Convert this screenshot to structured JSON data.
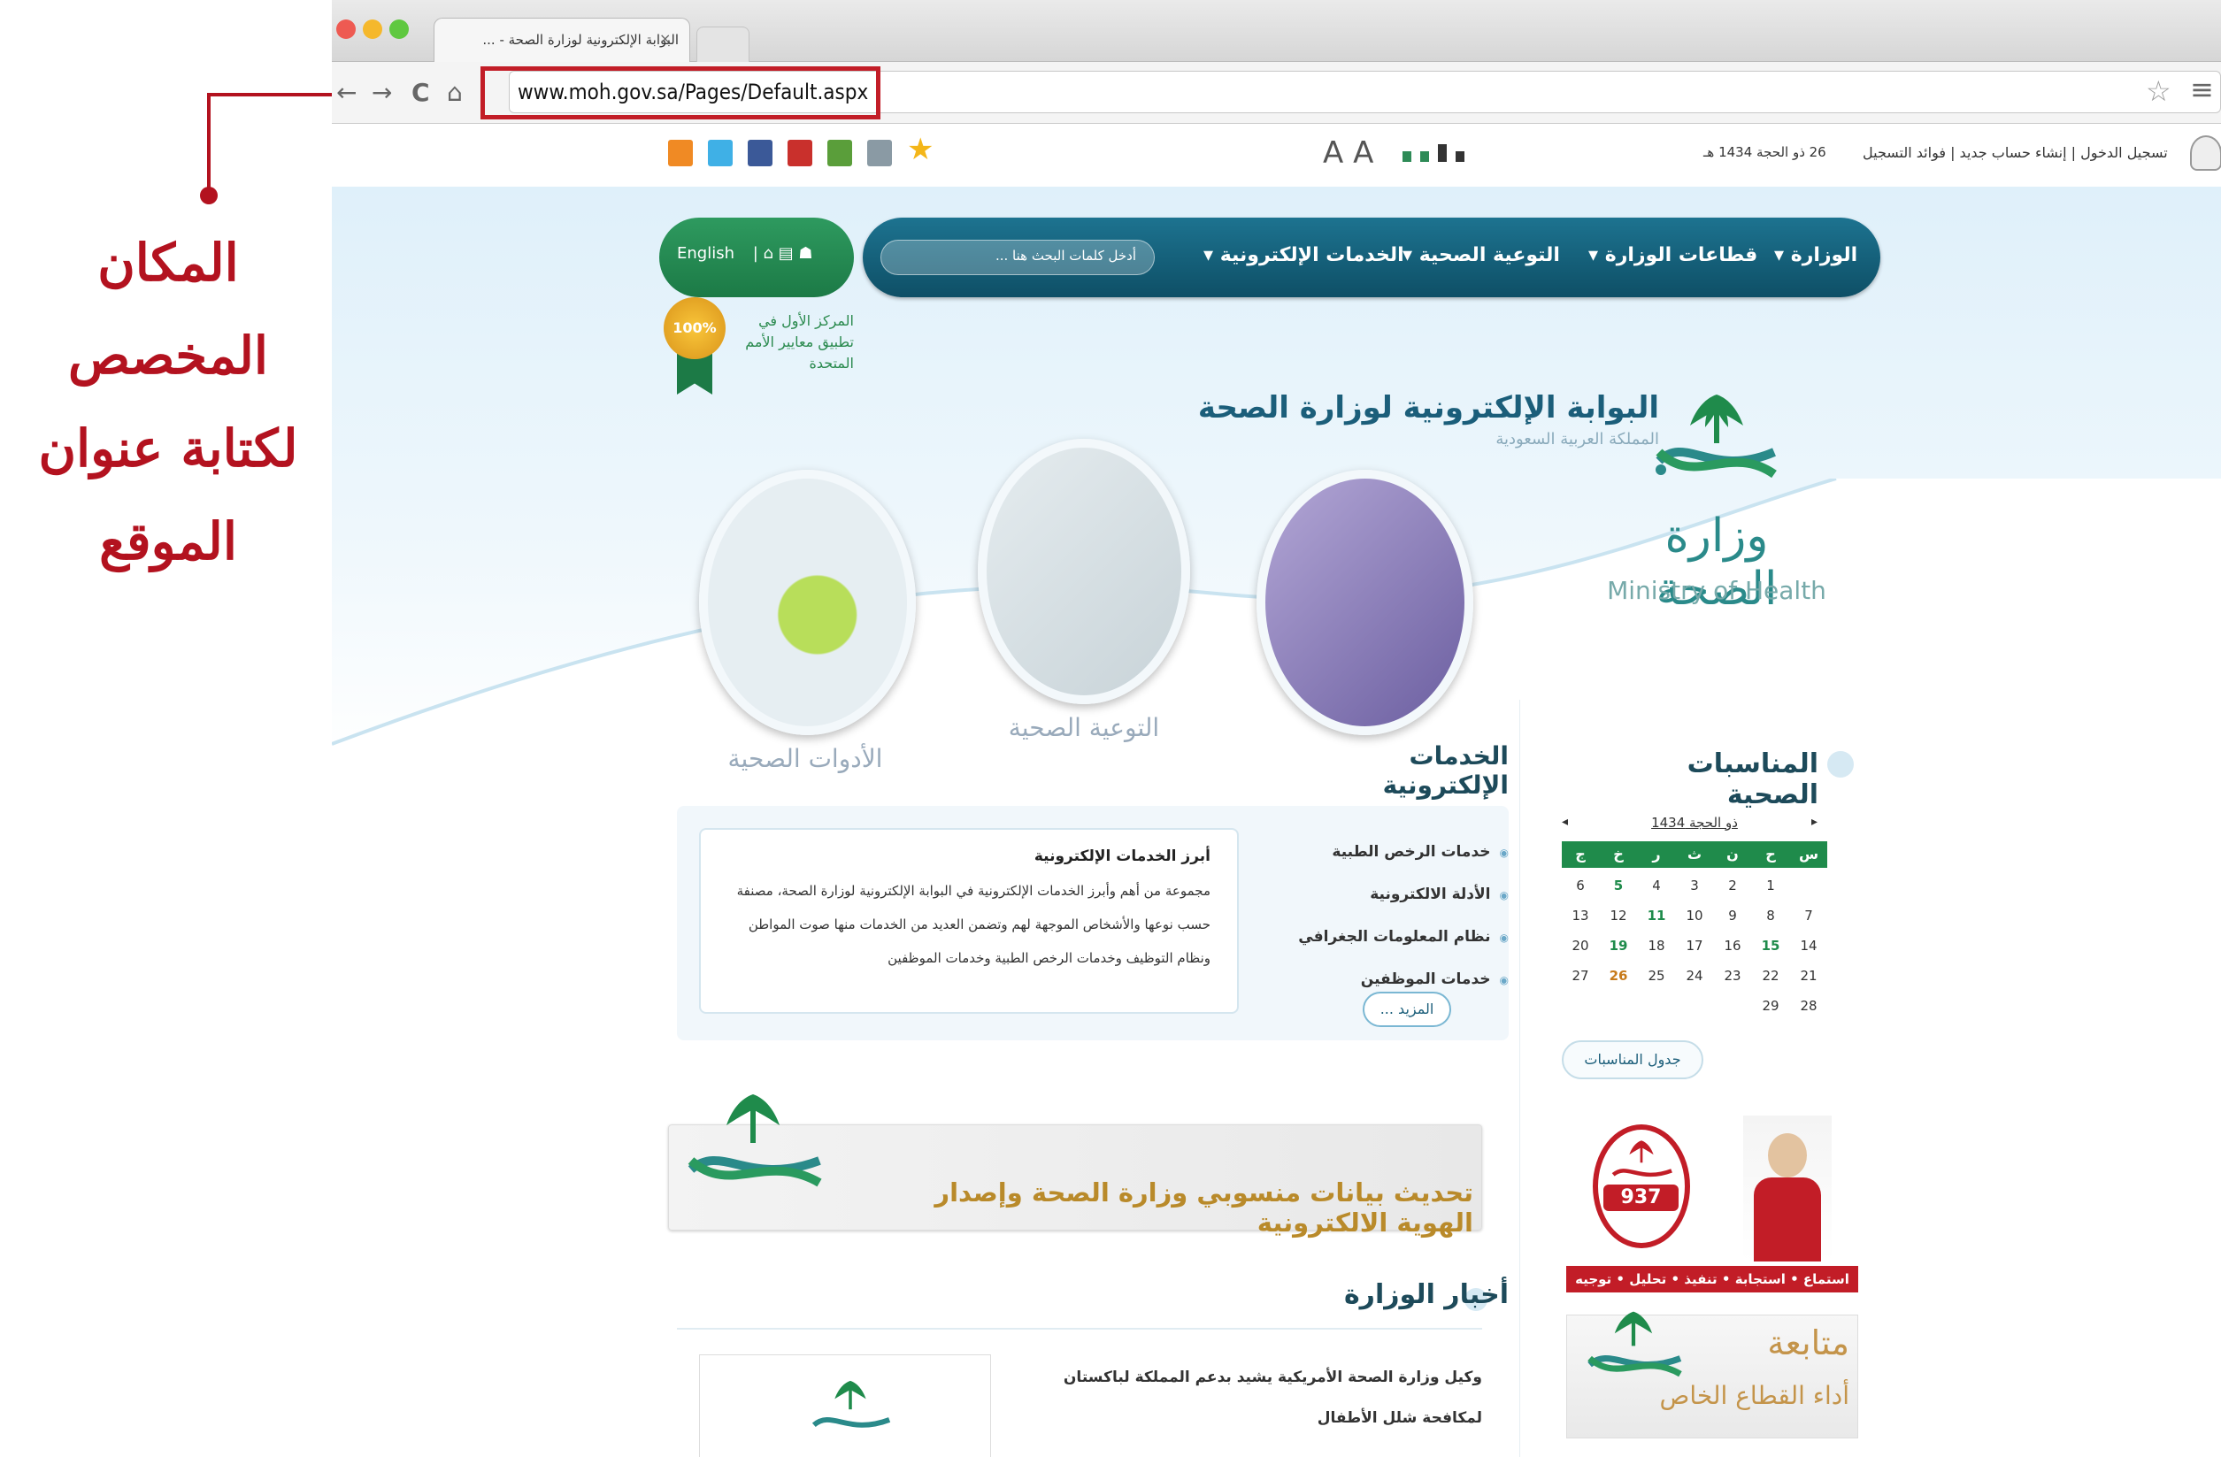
{
  "annotation": {
    "text_lines": [
      "المكان",
      "المخصص",
      "لكتابة عنوان",
      "الموقع"
    ],
    "color": "#b3121f"
  },
  "browser": {
    "tab_title": "البوابة الإلكترونية لوزارة الصحة - ...",
    "tab_close": "×",
    "url": "www.moh.gov.sa/Pages/Default.aspx",
    "nav_back": "←",
    "nav_forward": "→",
    "nav_reload": "C",
    "nav_home": "⌂",
    "bookmark_icon": "☆",
    "menu_icon": "≡"
  },
  "topbar": {
    "login_links": "تسجيل الدخول | إنشاء حساب جديد | فوائد التسجيل",
    "hijri_date": "26 ذو الحجة 1434 هـ",
    "font_size": "A A"
  },
  "navbar": {
    "items": [
      "الوزارة",
      "قطاعات الوزارة",
      "التوعية الصحية",
      "الخدمات الإلكترونية"
    ],
    "search_placeholder": "أدخل كلمات البحث هنا ..."
  },
  "lang_switch": {
    "label": "English"
  },
  "badge": {
    "percent": "100%",
    "text": "المركز الأول في تطبيق معايير الأمم المتحدة"
  },
  "portal": {
    "title": "البوابة الإلكترونية لوزارة الصحة",
    "subtitle": "المملكة العربية السعودية"
  },
  "logo": {
    "arabic": "وزارة الصحة",
    "english": "Ministry of Health"
  },
  "circles": {
    "tools": "الأدوات الصحية",
    "awareness": "التوعية الصحية"
  },
  "eservices": {
    "title": "الخدمات الإلكترونية",
    "box_title": "أبرز الخدمات الإلكترونية",
    "box_body": "مجموعة من أهم وأبرز الخدمات الإلكترونية في البوابة الإلكترونية لوزارة الصحة، مصنفة حسب نوعها والأشخاص الموجهة لهم وتضمن العديد من الخدمات منها صوت المواطن ونظام التوظيف وخدمات الرخص الطبية وخدمات الموظفين",
    "links": [
      "خدمات الرخص الطبية",
      "الأدلة الالكترونية",
      "نظام المعلومات الجغرافي",
      "خدمات الموظفين"
    ],
    "more": "المزيد ..."
  },
  "banner": {
    "text": "تحديث بيانات منسوبي وزارة الصحة وإصدار الهوية الالكترونية"
  },
  "news": {
    "title": "أخبار الوزارة",
    "headline": "وكيل وزارة الصحة الأمريكية يشيد بدعم المملكة لباكستان لمكافحة شلل الأطفال"
  },
  "events": {
    "title": "المناسبات الصحية",
    "calendar_header": "ذو الحجة 1434",
    "prev": "◂",
    "next": "▸",
    "weekdays": [
      "س",
      "ح",
      "ن",
      "ث",
      "ر",
      "خ",
      "ج"
    ],
    "rows": [
      [
        "1",
        "2",
        "3",
        "4",
        "5",
        "6"
      ],
      [
        "7",
        "8",
        "9",
        "10",
        "11",
        "12",
        "13"
      ],
      [
        "14",
        "15",
        "16",
        "17",
        "18",
        "19",
        "20"
      ],
      [
        "21",
        "22",
        "23",
        "24",
        "25",
        "26",
        "27"
      ],
      [
        "28",
        "29"
      ]
    ],
    "schedule_button": "جدول المناسبات"
  },
  "ad937": {
    "number": "937",
    "slogan": "استماع • استجابة • تنفيذ • تحليل • توجيه"
  },
  "follow": {
    "line1": "متابعة",
    "line2": "أداء القطاع الخاص"
  }
}
